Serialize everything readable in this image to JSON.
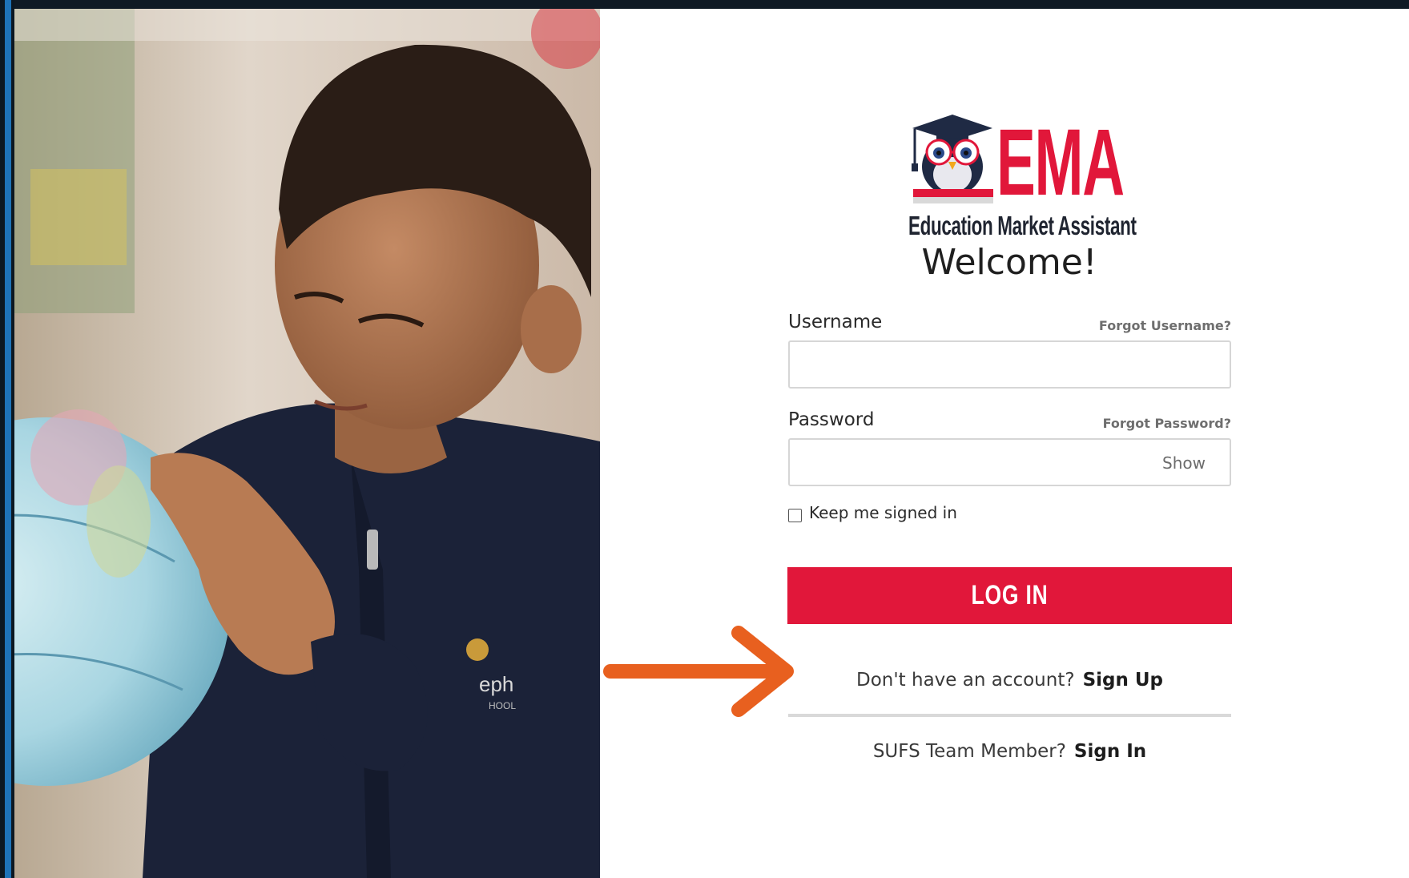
{
  "logo": {
    "wordmark": "EMA",
    "tagline": "Education Market Assistant",
    "icon": "owl-graduation-icon"
  },
  "welcome": "Welcome!",
  "username": {
    "label": "Username",
    "forgot": "Forgot Username?",
    "value": ""
  },
  "password": {
    "label": "Password",
    "forgot": "Forgot Password?",
    "value": "",
    "show_label": "Show"
  },
  "keep_signed_in": {
    "label": "Keep me signed in",
    "checked": false
  },
  "login_button": "LOG IN",
  "signup": {
    "prompt": "Don't have an account?",
    "link": "Sign Up"
  },
  "sufs": {
    "prompt": "SUFS Team Member?",
    "link": "Sign In"
  },
  "annotation": {
    "icon": "orange-arrow-icon",
    "color": "#e8601f"
  },
  "colors": {
    "brand_red": "#e1173a",
    "frame_blue": "#1e73b8"
  }
}
